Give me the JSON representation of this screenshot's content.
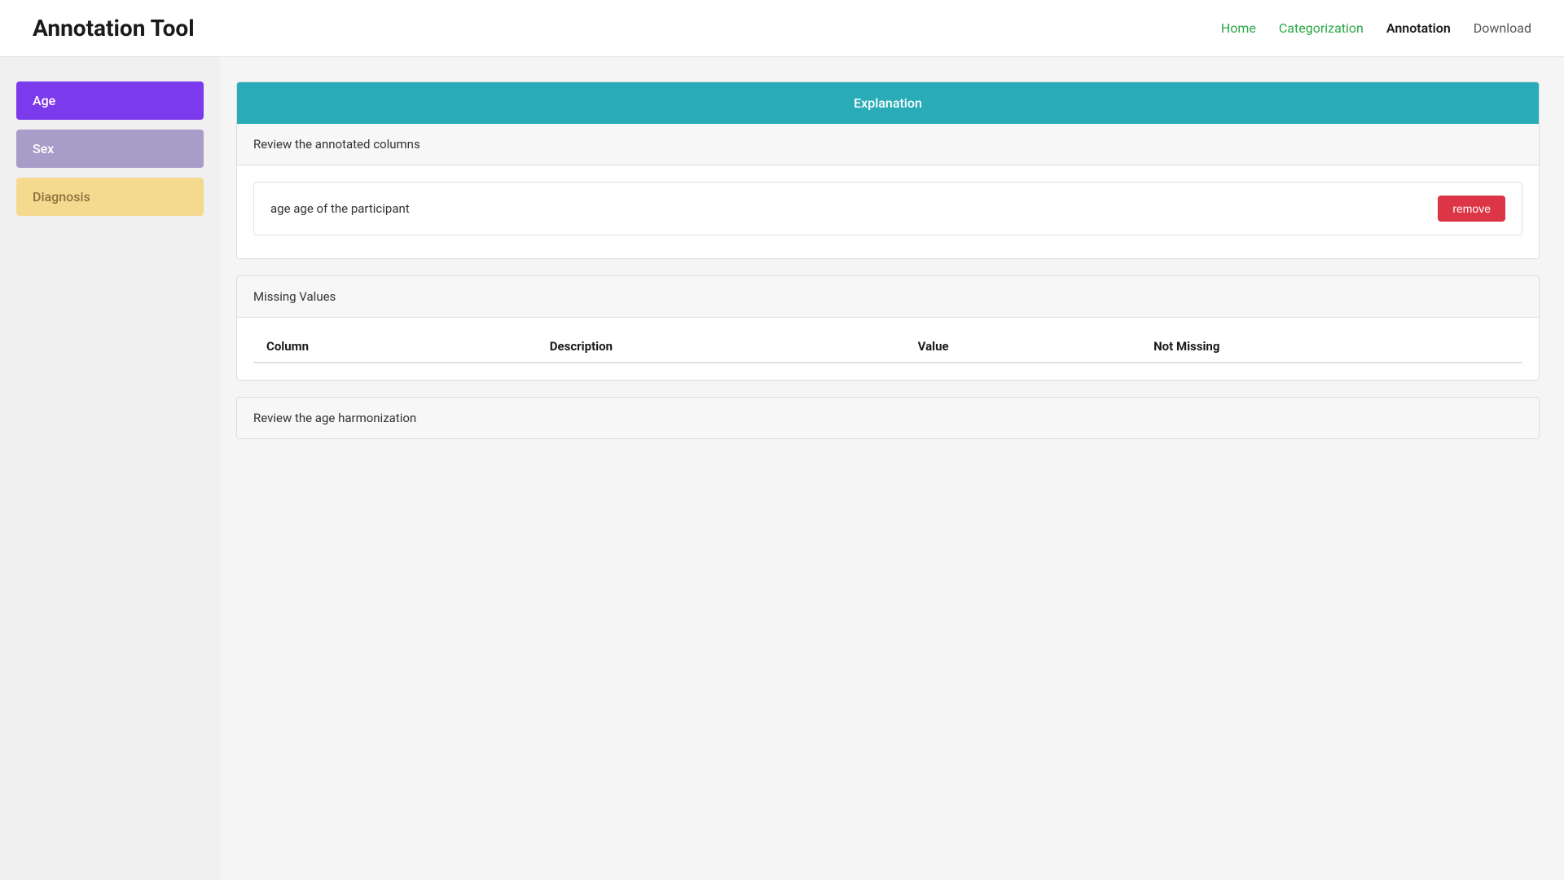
{
  "header": {
    "title": "Annotation Tool",
    "nav": [
      {
        "label": "Home",
        "style": "green"
      },
      {
        "label": "Categorization",
        "style": "green"
      },
      {
        "label": "Annotation",
        "style": "black"
      },
      {
        "label": "Download",
        "style": "gray"
      }
    ]
  },
  "sidebar": {
    "items": [
      {
        "label": "Age",
        "style": "active-purple"
      },
      {
        "label": "Sex",
        "style": "active-light-purple"
      },
      {
        "label": "Diagnosis",
        "style": "active-yellow"
      }
    ]
  },
  "main": {
    "panel_header": "Explanation",
    "review_section_label": "Review the annotated columns",
    "annotation_entry": {
      "text": "age age of the participant",
      "remove_label": "remove"
    },
    "missing_values": {
      "section_label": "Missing Values",
      "table_headers": [
        "Column",
        "Description",
        "Value",
        "Not Missing"
      ],
      "rows": []
    },
    "harmonization_section_label": "Review the age harmonization"
  }
}
